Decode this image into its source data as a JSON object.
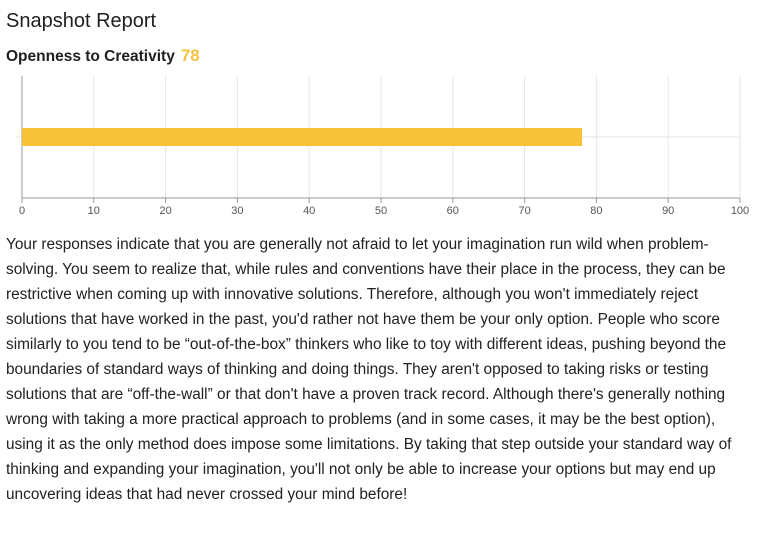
{
  "report": {
    "title": "Snapshot Report",
    "metric_label": "Openness to Creativity",
    "metric_score": "78",
    "description": "Your responses indicate that you are generally not afraid to let your imagination run wild when problem-solving. You seem to realize that, while rules and conventions have their place in the process, they can be restrictive when coming up with innovative solutions. Therefore, although you won't immediately reject solutions that have worked in the past, you'd rather not have them be your only option. People who score similarly to you tend to be “out-of-the-box” thinkers who like to toy with different ideas, pushing beyond the boundaries of standard ways of thinking and doing things. They aren't opposed to taking risks or testing solutions that are “off-the-wall” or that don't have a proven track record. Although there's generally nothing wrong with taking a more practical approach to problems (and in some cases, it may be the best option), using it as the only method does impose some limitations. By taking that step outside your standard way of thinking and expanding your imagination, you'll not only be able to increase your options but may end up uncovering ideas that had never crossed your mind before!"
  },
  "chart_data": {
    "type": "bar",
    "orientation": "horizontal",
    "categories": [
      ""
    ],
    "values": [
      78
    ],
    "xlim": [
      0,
      100
    ],
    "xticks": [
      0,
      10,
      20,
      30,
      40,
      50,
      60,
      70,
      80,
      90,
      100
    ],
    "grid": true,
    "bar_color": "#f8c13a",
    "grid_color": "#e6e6e6",
    "axis_color": "#999999"
  }
}
